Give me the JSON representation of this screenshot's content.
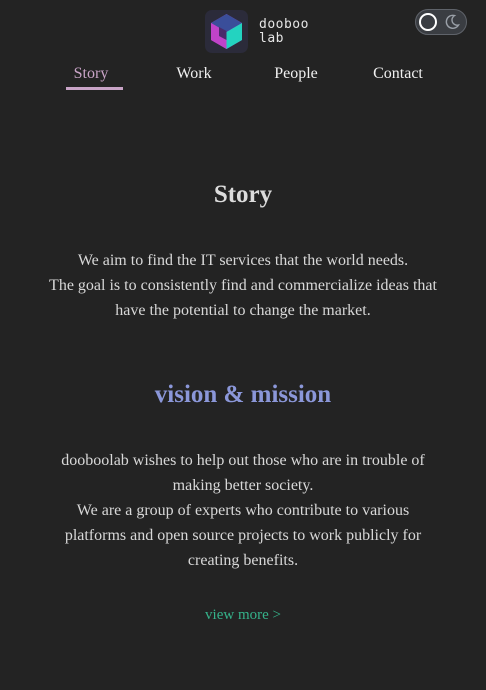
{
  "brand": {
    "name_line1": "dooboo",
    "name_line2": "lab"
  },
  "theme_toggle": {
    "state": "dark"
  },
  "nav": {
    "items": [
      {
        "label": "Story",
        "active": true
      },
      {
        "label": "Work",
        "active": false
      },
      {
        "label": "People",
        "active": false
      },
      {
        "label": "Contact",
        "active": false
      }
    ]
  },
  "story": {
    "title": "Story",
    "lines": [
      "We aim to find the IT services that the world needs.",
      "The goal is to consistently find and commercialize ideas that",
      "have the potential to change the market."
    ]
  },
  "vision": {
    "title": "vision & mission",
    "lines": [
      "dooboolab wishes to help out those who are in trouble of",
      "making better society.",
      "We are a group of experts who contribute to various",
      "platforms and open source projects to work publicly for",
      "creating benefits."
    ]
  },
  "view_more": {
    "label": "view more >"
  },
  "colors": {
    "background": "#232323",
    "active_nav": "#c9a4c7",
    "vision_title": "#8b97d9",
    "link": "#35b28a",
    "logo_purple": "#b43fc4",
    "logo_teal": "#23d3c0"
  },
  "icons": {
    "logo": "dooboolab-cube-logo",
    "toggle_knob": "sun-circle-icon",
    "toggle_moon": "moon-icon"
  }
}
